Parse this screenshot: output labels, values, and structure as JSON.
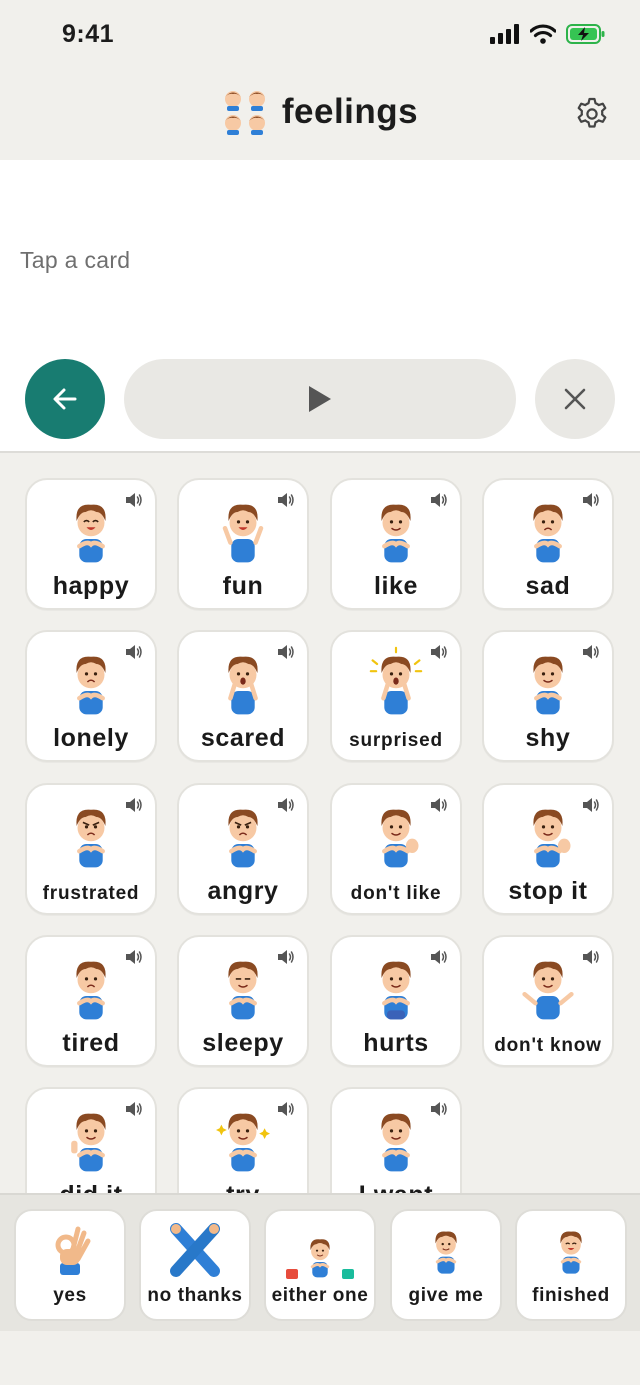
{
  "status": {
    "time": "9:41"
  },
  "header": {
    "title": "feelings",
    "icon": "children-faces-icon",
    "settings_icon": "gear-icon"
  },
  "message": {
    "placeholder": "Tap a card"
  },
  "controls": {
    "back_icon": "arrow-left-icon",
    "play_icon": "play-icon",
    "clear_icon": "close-icon"
  },
  "accent_colors": {
    "primary": "#187c71",
    "shirt": "#2f7fd6",
    "hair": "#8a4a22"
  },
  "cards": [
    {
      "label": "happy",
      "size": "big",
      "pose": "happy"
    },
    {
      "label": "fun",
      "size": "big",
      "pose": "fun"
    },
    {
      "label": "like",
      "size": "big",
      "pose": "like"
    },
    {
      "label": "sad",
      "size": "big",
      "pose": "sad"
    },
    {
      "label": "lonely",
      "size": "big",
      "pose": "lonely"
    },
    {
      "label": "scared",
      "size": "big",
      "pose": "scared"
    },
    {
      "label": "surprised",
      "size": "small",
      "pose": "surprised"
    },
    {
      "label": "shy",
      "size": "big",
      "pose": "shy"
    },
    {
      "label": "frustrated",
      "size": "small",
      "pose": "frustrated"
    },
    {
      "label": "angry",
      "size": "big",
      "pose": "angry"
    },
    {
      "label": "don't like",
      "size": "small",
      "pose": "dontlike"
    },
    {
      "label": "stop it",
      "size": "big",
      "pose": "stop"
    },
    {
      "label": "tired",
      "size": "big",
      "pose": "tired"
    },
    {
      "label": "sleepy",
      "size": "big",
      "pose": "sleepy"
    },
    {
      "label": "hurts",
      "size": "big",
      "pose": "hurts"
    },
    {
      "label": "don't know",
      "size": "small",
      "pose": "dontknow"
    },
    {
      "label": "did it",
      "size": "big",
      "pose": "didit"
    },
    {
      "label": "try",
      "size": "big",
      "pose": "try"
    },
    {
      "label": "I want",
      "size": "big",
      "pose": "want"
    }
  ],
  "quick_bar": [
    {
      "label": "yes",
      "icon": "ok-hand-icon"
    },
    {
      "label": "no thanks",
      "icon": "crossed-arms-icon"
    },
    {
      "label": "either one",
      "icon": "choose-either-icon"
    },
    {
      "label": "give me",
      "icon": "give-me-icon"
    },
    {
      "label": "finished",
      "icon": "finished-icon"
    }
  ]
}
